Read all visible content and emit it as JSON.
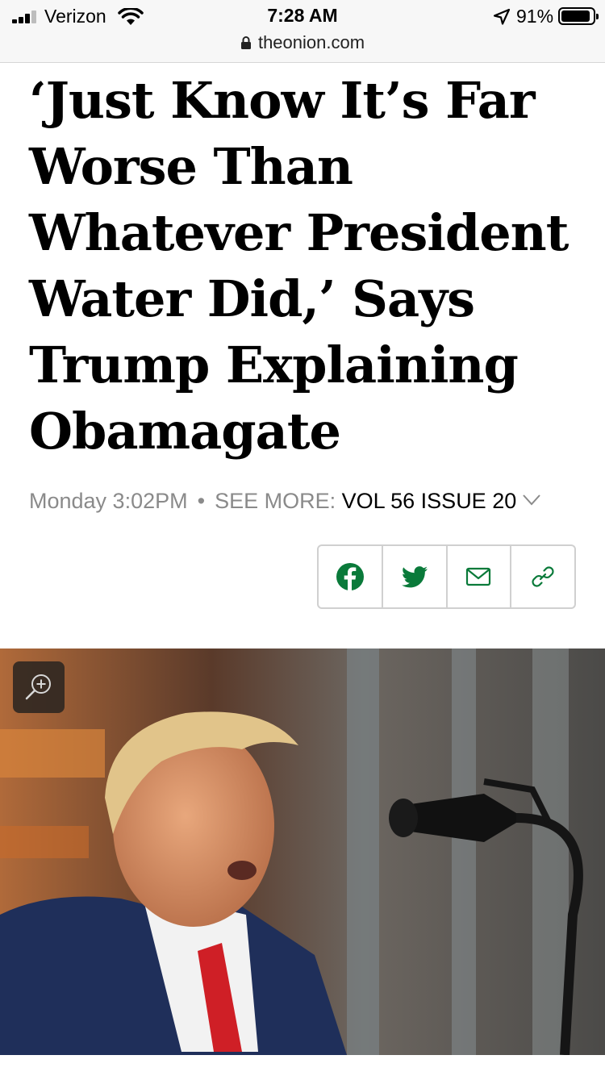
{
  "status_bar": {
    "carrier": "Verizon",
    "time": "7:28 AM",
    "battery": "91%",
    "battery_level": 0.91
  },
  "browser": {
    "url": "theonion.com"
  },
  "article": {
    "headline": "‘Just Know It’s Far Worse Than Whatever President Water Did,’ Says Trump Explaining Obamagate",
    "date": "Monday 3:02PM",
    "separator": "•",
    "see_more_label": "SEE MORE:",
    "issue": "VOL 56 ISSUE 20"
  },
  "share": {
    "accent_color": "#0a7a3a",
    "buttons": [
      {
        "icon": "facebook-icon"
      },
      {
        "icon": "twitter-icon"
      },
      {
        "icon": "email-icon"
      },
      {
        "icon": "link-icon"
      }
    ]
  },
  "photo": {
    "zoom_icon": "zoom-in-icon"
  }
}
